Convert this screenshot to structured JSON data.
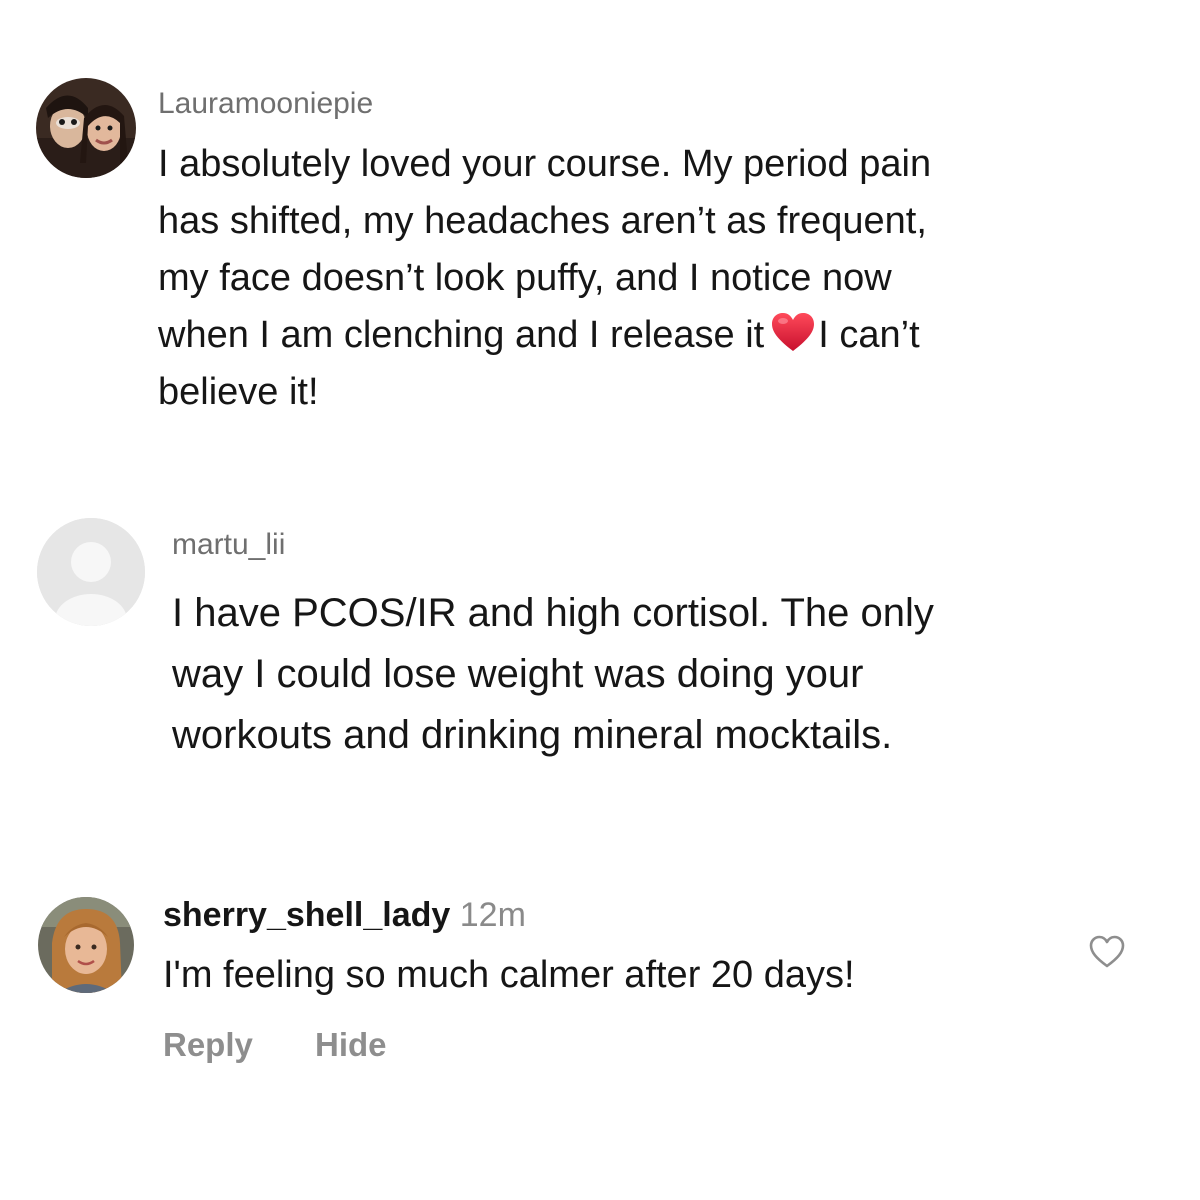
{
  "comments": [
    {
      "username": "Lauramooniepie",
      "lines": [
        "I absolutely loved your course. My period pain",
        "has shifted, my headaches aren’t as frequent,",
        "my face doesn’t look puffy, and I notice now",
        "believe it!"
      ],
      "line4_before_emoji": "when I am clenching and I release it",
      "line4_after_emoji": "I can’t",
      "emoji_icon": "red-heart-icon",
      "avatar_icon": "two-people-photo-avatar"
    },
    {
      "username": "martu_lii",
      "lines": [
        "I have PCOS/IR and high cortisol. The only",
        "way I could lose weight was doing your",
        "workouts and drinking mineral mocktails."
      ],
      "avatar_icon": "default-user-avatar"
    },
    {
      "username": "sherry_shell_lady",
      "time": "12m",
      "text": "I'm feeling so much calmer after 20 days!",
      "reply_label": "Reply",
      "hide_label": "Hide",
      "like_icon": "heart-outline-icon",
      "avatar_icon": "woman-photo-avatar"
    }
  ],
  "colors": {
    "username": "#6f6f6f",
    "text": "#161616",
    "secondary": "#8e8e8e",
    "heart_red": "#e0203a",
    "avatar_placeholder": "#e4e4e4"
  }
}
